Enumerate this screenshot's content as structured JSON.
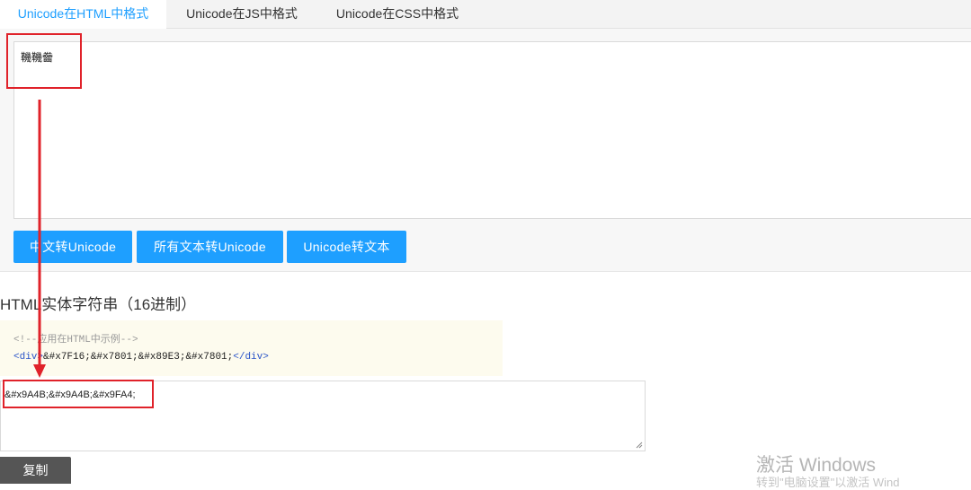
{
  "tabs": [
    {
      "label": "Unicode在HTML中格式",
      "active": true
    },
    {
      "label": "Unicode在JS中格式",
      "active": false
    },
    {
      "label": "Unicode在CSS中格式",
      "active": false
    }
  ],
  "input": {
    "value": "鞿鞿齤"
  },
  "buttons": {
    "cn_to_unicode": "中文转Unicode",
    "all_to_unicode": "所有文本转Unicode",
    "unicode_to_text": "Unicode转文本"
  },
  "section": {
    "title": "HTML实体字符串（16进制）"
  },
  "example": {
    "comment": "<!--应用在HTML中示例-->",
    "open_tag": "<div>",
    "entities": "&#x7F16;&#x7801;&#x89E3;&#x7801;",
    "close_tag": "</div>"
  },
  "output": {
    "value": "&#x9A4B;&#x9A4B;&#x9FA4;"
  },
  "copy": {
    "label": "复制"
  },
  "watermark": {
    "title": "激活 Windows",
    "subtitle": "转到\"电脑设置\"以激活 Wind"
  },
  "colors": {
    "accent": "#1e9fff",
    "annotation": "#e0222a",
    "code_bg": "#fdfbee"
  }
}
